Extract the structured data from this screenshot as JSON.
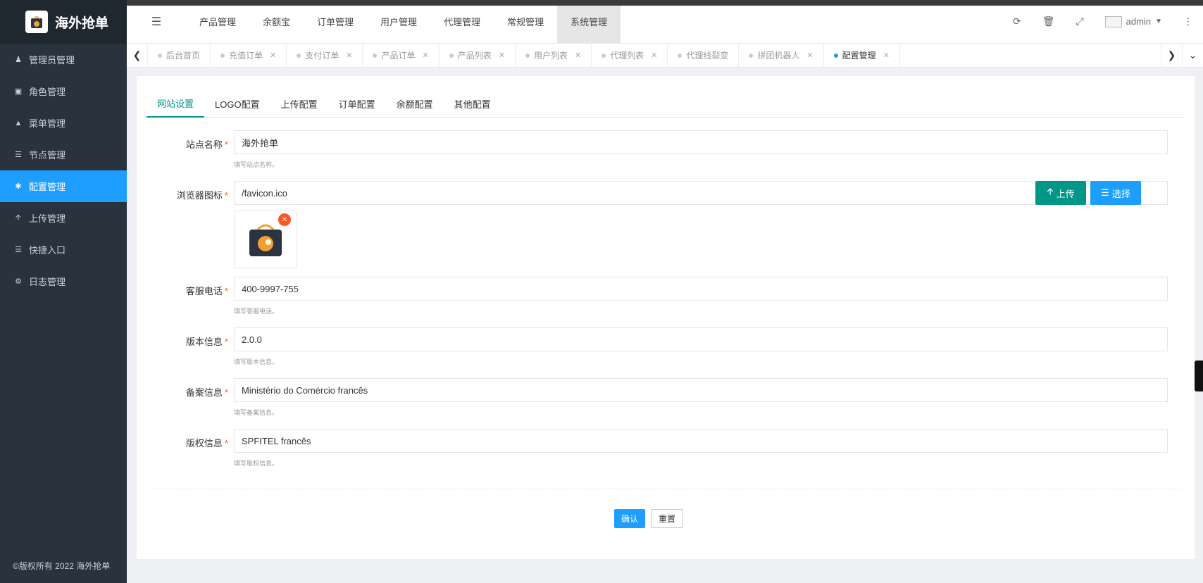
{
  "brand": {
    "name": "海外抢单"
  },
  "sidebar": {
    "items": [
      {
        "label": "管理员管理",
        "icon": "user-icon"
      },
      {
        "label": "角色管理",
        "icon": "role-icon"
      },
      {
        "label": "菜单管理",
        "icon": "tree-icon"
      },
      {
        "label": "节点管理",
        "icon": "list-icon"
      },
      {
        "label": "配置管理",
        "icon": "gear-icon",
        "active": true
      },
      {
        "label": "上传管理",
        "icon": "arrow-up-icon"
      },
      {
        "label": "快捷入口",
        "icon": "list-icon"
      },
      {
        "label": "日志管理",
        "icon": "log-icon"
      }
    ],
    "copyright": "©版权所有 2022 海外抢单"
  },
  "topnav": {
    "items": [
      "产品管理",
      "余额宝",
      "订单管理",
      "用户管理",
      "代理管理",
      "常规管理",
      "系统管理"
    ],
    "active_index": 6,
    "user": "admin"
  },
  "tabs": {
    "items": [
      {
        "label": "后台首页",
        "closable": false
      },
      {
        "label": "充值订单",
        "closable": true
      },
      {
        "label": "支付订单",
        "closable": true
      },
      {
        "label": "产品订单",
        "closable": true
      },
      {
        "label": "产品列表",
        "closable": true
      },
      {
        "label": "用户列表",
        "closable": true
      },
      {
        "label": "代理列表",
        "closable": true
      },
      {
        "label": "代理线裂变",
        "closable": false
      },
      {
        "label": "拼团机器人",
        "closable": true
      },
      {
        "label": "配置管理",
        "closable": true,
        "active": true
      }
    ]
  },
  "subtabs": [
    "网站设置",
    "LOGO配置",
    "上传配置",
    "订单配置",
    "余额配置",
    "其他配置"
  ],
  "form": {
    "site_name": {
      "label": "站点名称",
      "value": "海外抢单",
      "hint": "填写站点名称。"
    },
    "favicon": {
      "label": "浏览器图标",
      "value": "/favicon.ico",
      "upload_label": "上传",
      "select_label": "选择"
    },
    "phone": {
      "label": "客服电话",
      "value": "400-9997-755",
      "hint": "填写客服电话。"
    },
    "version": {
      "label": "版本信息",
      "value": "2.0.0",
      "hint": "填写版本信息。"
    },
    "icp": {
      "label": "备案信息",
      "value": "Ministério do Comércio francês",
      "hint": "填写备案信息。"
    },
    "copyright": {
      "label": "版权信息",
      "value": "SPFITEL francês",
      "hint": "填写版权信息。"
    },
    "confirm_label": "确认",
    "reset_label": "重置"
  },
  "colors": {
    "accent": "#1e9fff",
    "green": "#009688",
    "sidebar": "#28333e",
    "required": "#ff5722"
  }
}
